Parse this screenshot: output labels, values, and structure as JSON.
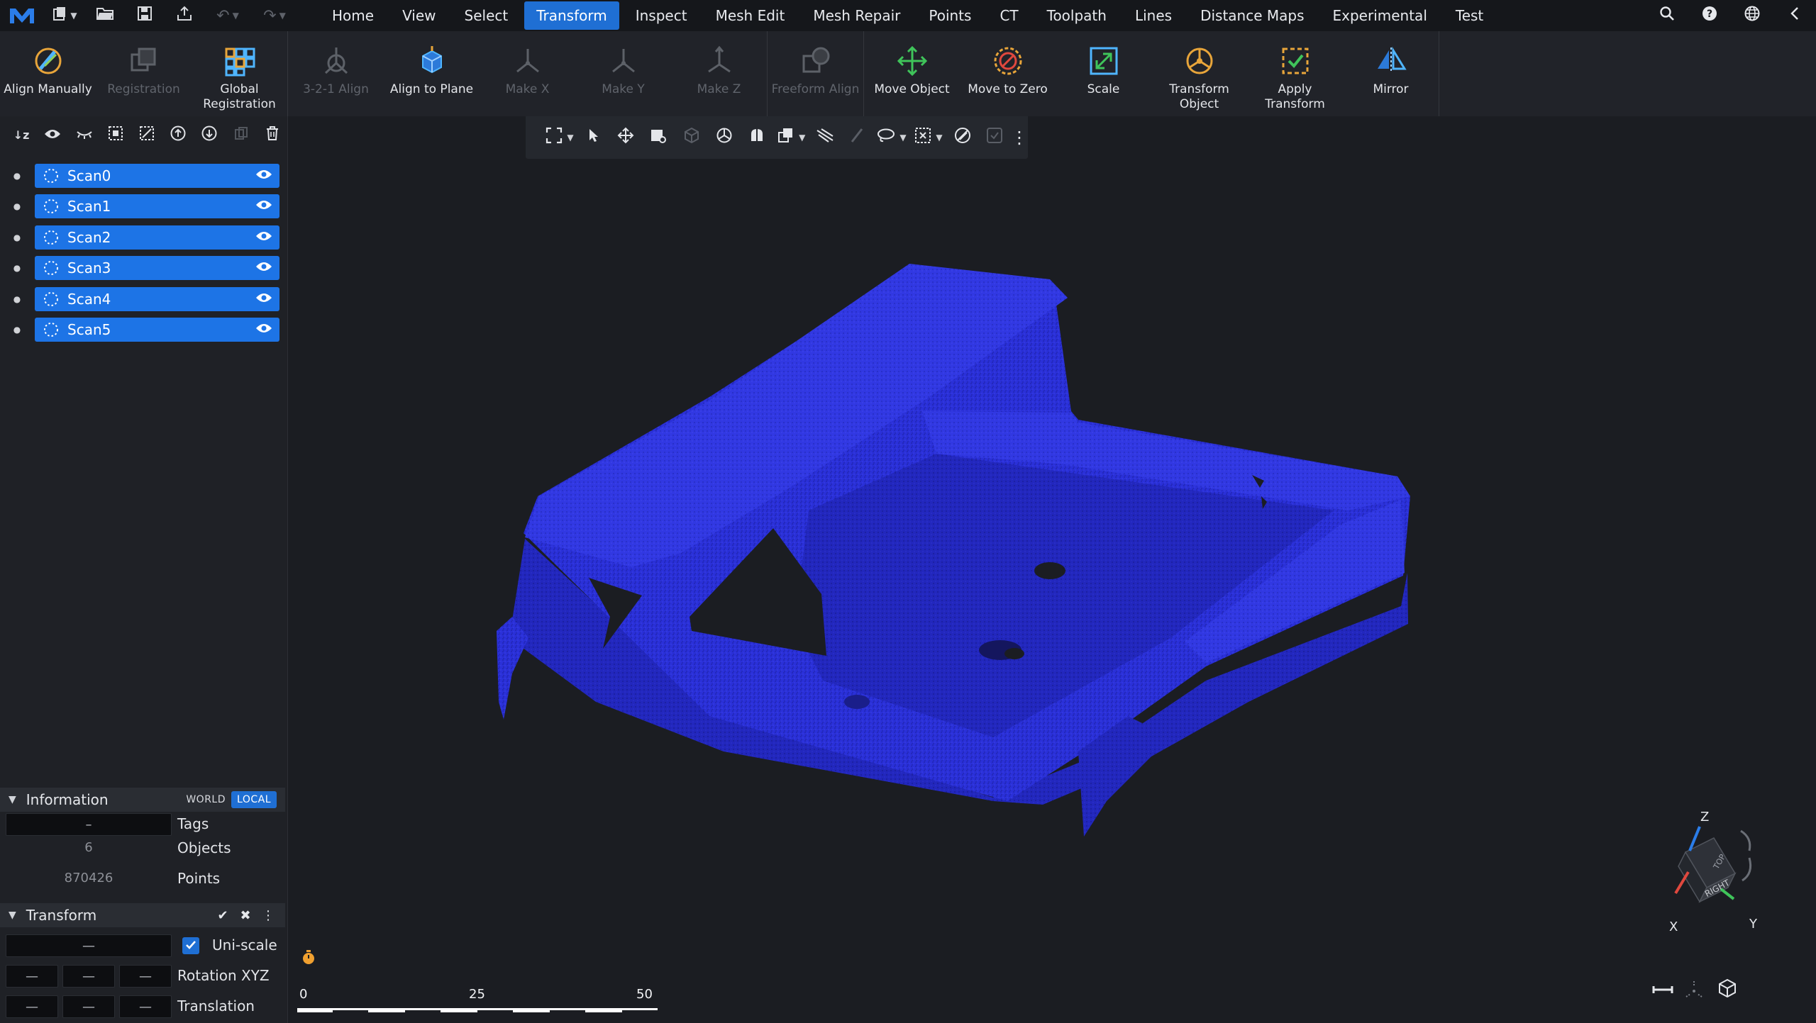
{
  "menu": {
    "items": [
      "Home",
      "View",
      "Select",
      "Transform",
      "Inspect",
      "Mesh Edit",
      "Mesh Repair",
      "Points",
      "CT",
      "Toolpath",
      "Lines",
      "Distance Maps",
      "Experimental",
      "Test"
    ],
    "active": "Transform"
  },
  "ribbon": {
    "align_manually": "Align Manually",
    "registration": "Registration",
    "global_registration_1": "Global",
    "global_registration_2": "Registration",
    "align_321": "3-2-1 Align",
    "align_to_plane": "Align to Plane",
    "make_x": "Make X",
    "make_y": "Make Y",
    "make_z": "Make Z",
    "freeform_align": "Freeform Align",
    "move_object": "Move Object",
    "move_to_zero": "Move to Zero",
    "scale": "Scale",
    "transform_object_1": "Transform",
    "transform_object_2": "Object",
    "apply_transform_1": "Apply",
    "apply_transform_2": "Transform",
    "mirror": "Mirror"
  },
  "scene_tree": {
    "items": [
      {
        "label": "Scan0"
      },
      {
        "label": "Scan1"
      },
      {
        "label": "Scan2"
      },
      {
        "label": "Scan3"
      },
      {
        "label": "Scan4"
      },
      {
        "label": "Scan5"
      }
    ]
  },
  "information": {
    "title": "Information",
    "world": "WORLD",
    "local": "LOCAL",
    "tags_value": "–",
    "tags_label": "Tags",
    "objects_value": "6",
    "objects_label": "Objects",
    "points_value": "870426",
    "points_label": "Points"
  },
  "transform": {
    "title": "Transform",
    "scale_value": "—",
    "uniscale_label": "Uni-scale",
    "uniscale_checked": true,
    "rotation_values": [
      "—",
      "—",
      "—"
    ],
    "rotation_label": "Rotation XYZ",
    "translation_values": [
      "—",
      "—",
      "—"
    ],
    "translation_label": "Translation"
  },
  "scale_bar": {
    "ticks": [
      "0",
      "25",
      "50"
    ]
  },
  "view_cube": {
    "face_top": "TOP",
    "face_right": "RIGHT",
    "axis_x": "X",
    "axis_y": "Y",
    "axis_z": "Z"
  },
  "colors": {
    "accent": "#1f6fd4",
    "mesh": "#2b2fd6",
    "background": "#1b1d22"
  }
}
